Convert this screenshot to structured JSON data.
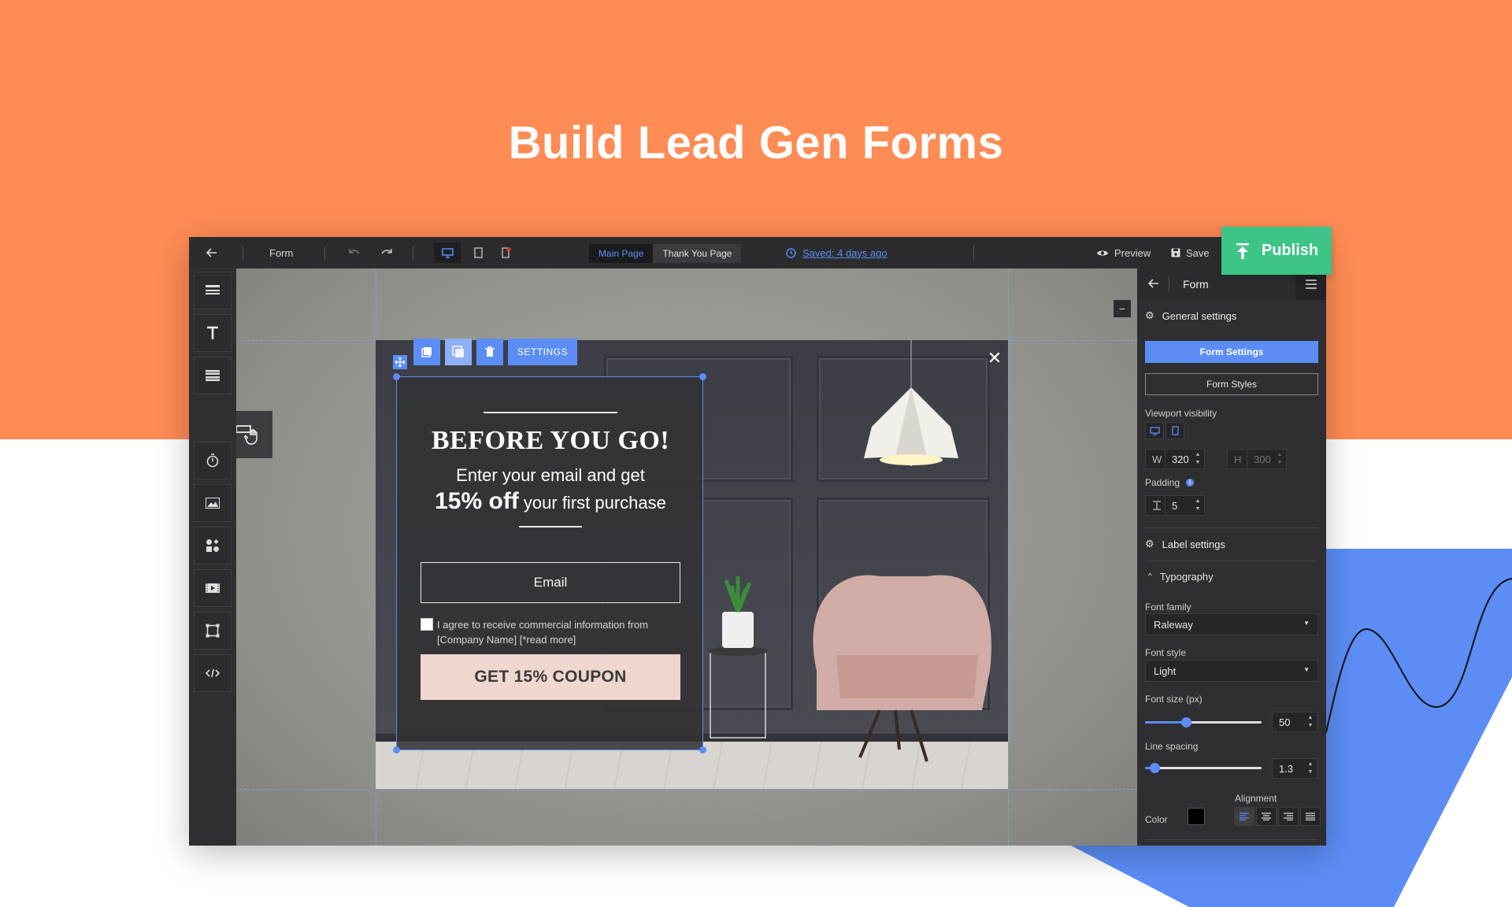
{
  "hero": {
    "title": "Build Lead Gen Forms"
  },
  "topbar": {
    "back_icon": "arrow-left-icon",
    "doc_name": "Form",
    "main_page_tab": "Main Page",
    "thank_you_tab": "Thank You Page",
    "saved_text": "Saved: 4 days ago",
    "preview_label": "Preview",
    "save_label": "Save",
    "publish_label": "Publish"
  },
  "popup": {
    "toolbar": {
      "settings_label": "SETTINGS"
    },
    "title": "BEFORE YOU GO!",
    "subtitle_line1": "Enter your email and get",
    "subtitle_bold": "15% off",
    "subtitle_rest": " your first purchase",
    "email_placeholder": "Email",
    "consent_text": "I agree to receive commercial information from [Company Name] [*read more]",
    "button_label": "GET 15% COUPON",
    "close_icon": "close-icon"
  },
  "right_panel": {
    "title": "Form",
    "general_settings": "General settings",
    "form_settings_btn": "Form Settings",
    "form_styles_btn": "Form Styles",
    "viewport_label": "Viewport visibility",
    "w_label": "W",
    "w_value": "320",
    "h_label": "H",
    "h_value": "300",
    "padding_label": "Padding",
    "padding_value": "5",
    "label_settings": "Label settings",
    "typography": "Typography",
    "font_family_label": "Font family",
    "font_family_value": "Raleway",
    "font_style_label": "Font style",
    "font_style_value": "Light",
    "font_size_label": "Font size (px)",
    "font_size_value": "50",
    "font_size_level": 0.35,
    "line_spacing_label": "Line spacing",
    "line_spacing_value": "1.3",
    "line_spacing_level": 0.08,
    "alignment_label": "Alignment",
    "color_label": "Color",
    "color_value": "#000000"
  },
  "colors": {
    "hero_orange": "#FF8B55",
    "accent_blue": "#5B8DF5",
    "publish_green": "#3DC487",
    "coupon_pink": "#EFD6CE"
  }
}
